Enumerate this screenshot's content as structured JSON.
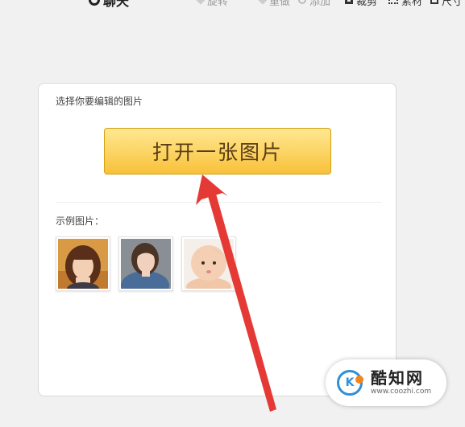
{
  "toolbar": {
    "search_label": "聊天",
    "items": [
      "旋转",
      "重做",
      "添加",
      "裁剪",
      "素材",
      "尺寸"
    ]
  },
  "editor": {
    "section_label": "选择你要编辑的图片",
    "open_button": "打开一张图片",
    "examples_label": "示例图片："
  },
  "watermark": {
    "title": "酷知网",
    "url": "www.coozhi.com"
  },
  "colors": {
    "button_top": "#ffe892",
    "button_bottom": "#f8c13a",
    "button_text": "#5a3d14",
    "arrow": "#e53935",
    "watermark_logo_blue": "#2f8fd8",
    "watermark_logo_orange": "#f5841f"
  }
}
